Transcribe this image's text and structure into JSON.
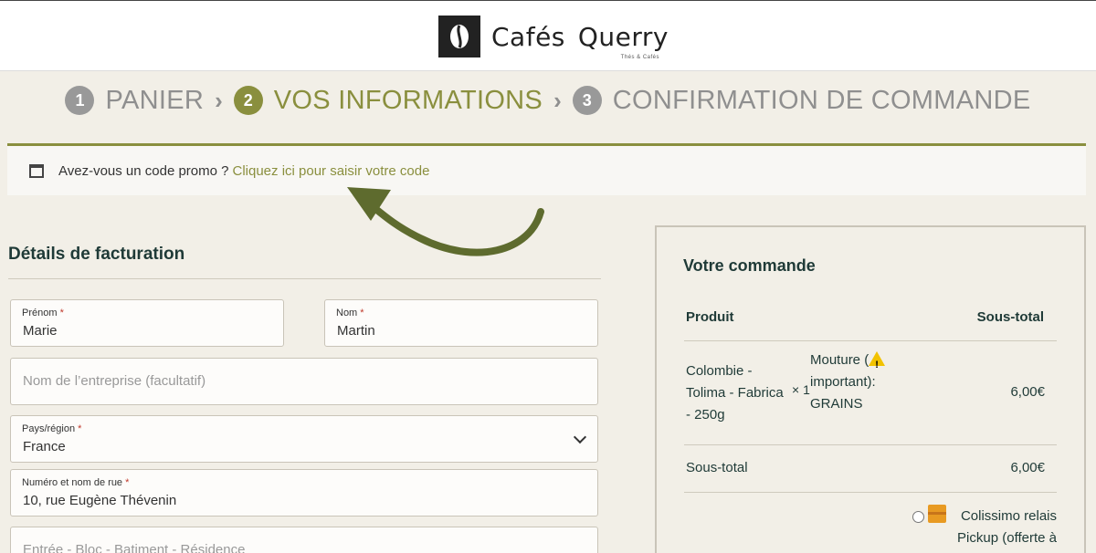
{
  "brand": {
    "name_first": "Cafés",
    "name_second": "Querry",
    "tagline": "Thés & Cafés"
  },
  "steps": [
    {
      "num": "1",
      "label": "PANIER"
    },
    {
      "num": "2",
      "label": "VOS INFORMATIONS"
    },
    {
      "num": "3",
      "label": "CONFIRMATION DE COMMANDE"
    }
  ],
  "promo": {
    "text": "Avez-vous un code promo ?",
    "link": "Cliquez ici pour saisir votre code"
  },
  "billing": {
    "title": "Détails de facturation",
    "first_name": {
      "label": "Prénom",
      "required": "*",
      "value": "Marie"
    },
    "last_name": {
      "label": "Nom",
      "required": "*",
      "value": "Martin"
    },
    "company": {
      "placeholder": "Nom de l’entreprise (facultatif)"
    },
    "country": {
      "label": "Pays/région",
      "required": "*",
      "value": "France"
    },
    "street": {
      "label": "Numéro et nom de rue",
      "required": "*",
      "value": "10, rue Eugène Thévenin"
    },
    "address2": {
      "placeholder": "Entrée - Bloc - Batiment - Résidence"
    }
  },
  "order": {
    "title": "Votre commande",
    "col_product": "Produit",
    "col_subtotal": "Sous-total",
    "item": {
      "name": "Colombie - Tolima - Fabrica - 250g",
      "qty": "× 1",
      "variation_a": "Mouture (",
      "variation_b": "important): GRAINS",
      "price": "6,00€"
    },
    "subtotal_label": "Sous-total",
    "subtotal_value": "6,00€",
    "shipping_label": "Colissimo relais Pickup (offerte à"
  },
  "colors": {
    "accent": "#8a8f3e",
    "background": "#f2efe7",
    "text": "#1f3a37"
  }
}
